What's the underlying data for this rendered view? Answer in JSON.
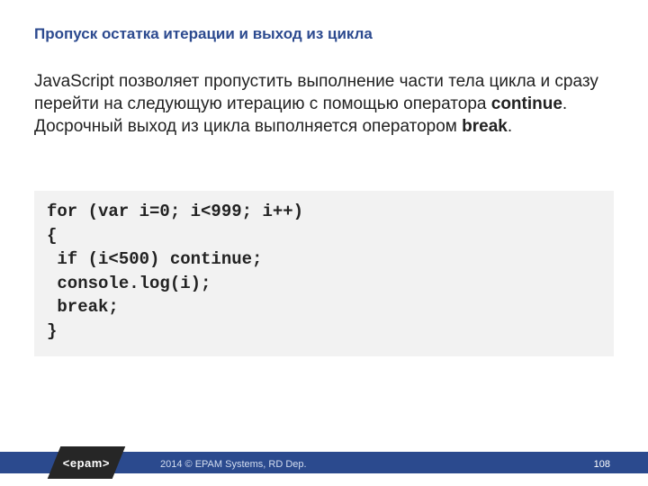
{
  "slide": {
    "title": "Пропуск остатка итерации и выход из цикла",
    "body_plain": "JavaScript позволяет пропустить выполнение части тела цикла и сразу перейти на следующую итерацию с помощью оператора continue. Досрочный выход из цикла выполняется оператором break.",
    "body_parts": {
      "p1": "JavaScript позволяет пропустить выполнение части тела цикла и сразу перейти на следующую итерацию с помощью оператора ",
      "s1": "continue",
      "p2": ". Досрочный выход из цикла выполняется оператором ",
      "s2": "break",
      "p3": "."
    },
    "code": "for (var i=0; i<999; i++)\n{\n if (i<500) continue;\n console.log(i);\n break;\n}"
  },
  "footer": {
    "logo_text": "<epam>",
    "copyright": "2014 © EPAM Systems, RD Dep.",
    "page": "108"
  },
  "colors": {
    "title": "#2c4a8f",
    "footer_bar": "#2b4a8e",
    "code_bg": "#f2f2f2",
    "logo_bg": "#262626"
  }
}
